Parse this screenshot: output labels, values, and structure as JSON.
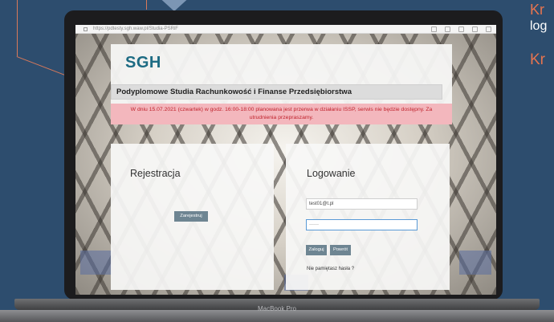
{
  "side": {
    "kr_top": "Kr",
    "log": "log",
    "kr_bottom": "Kr"
  },
  "browser": {
    "url": "https://pdtesty.sgh.waw.pl/Studia-PSRiF"
  },
  "header": {
    "logo": "SGH",
    "title": "Podyplomowe Studia Rachunkowość i Finanse Przedsiębiorstwa"
  },
  "notice": {
    "text": "W dniu 15.07.2021 (czwartek) w godz. 16:00-18:00 planowana jest przerwa w działaniu ISSP, serwis nie będzie dostępny. Za utrudnienia przepraszamy."
  },
  "registration": {
    "title": "Rejestracja",
    "button": "Zarejestruj"
  },
  "login": {
    "title": "Logowanie",
    "email_value": "test01@t.pl",
    "password_value": "······",
    "login_button": "Zaloguj",
    "back_button": "Powrót",
    "forgot_link": "Nie pamiętasz hasła ?"
  },
  "device": {
    "label": "MacBook Pro"
  },
  "colors": {
    "background": "#2d4d6e",
    "accent": "#e6744f",
    "logo": "#1d6b83",
    "button": "#6e8592",
    "notice_bg": "#f3b7bd",
    "notice_text": "#c0222c"
  }
}
